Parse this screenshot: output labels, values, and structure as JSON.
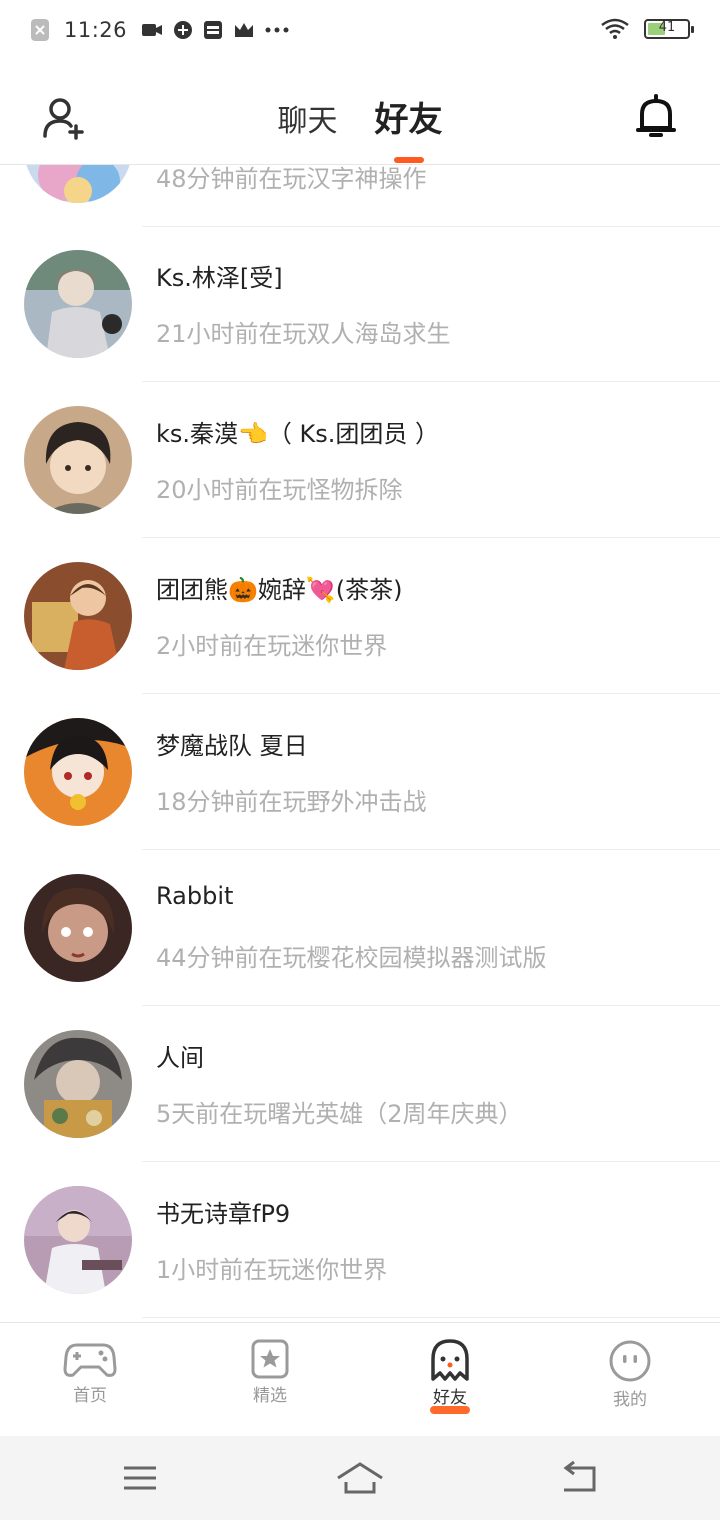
{
  "status_bar": {
    "time": "11:26",
    "battery_level": "41",
    "icons": [
      "notification-x-icon",
      "video-icon",
      "app-icon",
      "sim-icon",
      "crown-icon",
      "more-dots-icon",
      "wifi-icon",
      "battery-icon"
    ]
  },
  "header": {
    "tabs": [
      {
        "label": "聊天",
        "active": false
      },
      {
        "label": "好友",
        "active": true
      }
    ],
    "add_friend_icon": "add-user-icon",
    "notification_icon": "bell-icon"
  },
  "friends": [
    {
      "name": "",
      "status": "48分钟前在玩汉字神操作",
      "avatar_color": "#a9c6e8"
    },
    {
      "name": "Ks.林泽[受]",
      "status": "21小时前在玩双人海岛求生",
      "avatar_color": "#8f9ea8"
    },
    {
      "name": "ks.秦漠👈（ Ks.团团员 ）",
      "status": "20小时前在玩怪物拆除",
      "avatar_color": "#6b5644"
    },
    {
      "name": "团团熊🎃婉辞💘(茶茶)",
      "status": "2小时前在玩迷你世界",
      "avatar_color": "#b0673d"
    },
    {
      "name": "梦魔战队 夏日",
      "status": "18分钟前在玩野外冲击战",
      "avatar_color": "#e58a2e"
    },
    {
      "name": "Rabbit",
      "status": "44分钟前在玩樱花校园模拟器测试版",
      "avatar_color": "#5a3a30"
    },
    {
      "name": "人间",
      "status": "5天前在玩曙光英雄（2周年庆典）",
      "avatar_color": "#6f6a66"
    },
    {
      "name": "书无诗章fP9",
      "status": "1小时前在玩迷你世界",
      "avatar_color": "#8a7088"
    }
  ],
  "bottom_nav": [
    {
      "label": "首页",
      "icon": "gamepad-icon",
      "active": false
    },
    {
      "label": "精选",
      "icon": "star-bookmark-icon",
      "active": false
    },
    {
      "label": "好友",
      "icon": "ghost-icon",
      "active": true
    },
    {
      "label": "我的",
      "icon": "face-icon",
      "active": false
    }
  ],
  "colors": {
    "accent": "#ff5a1f",
    "status_text": "#b0b0b0"
  }
}
